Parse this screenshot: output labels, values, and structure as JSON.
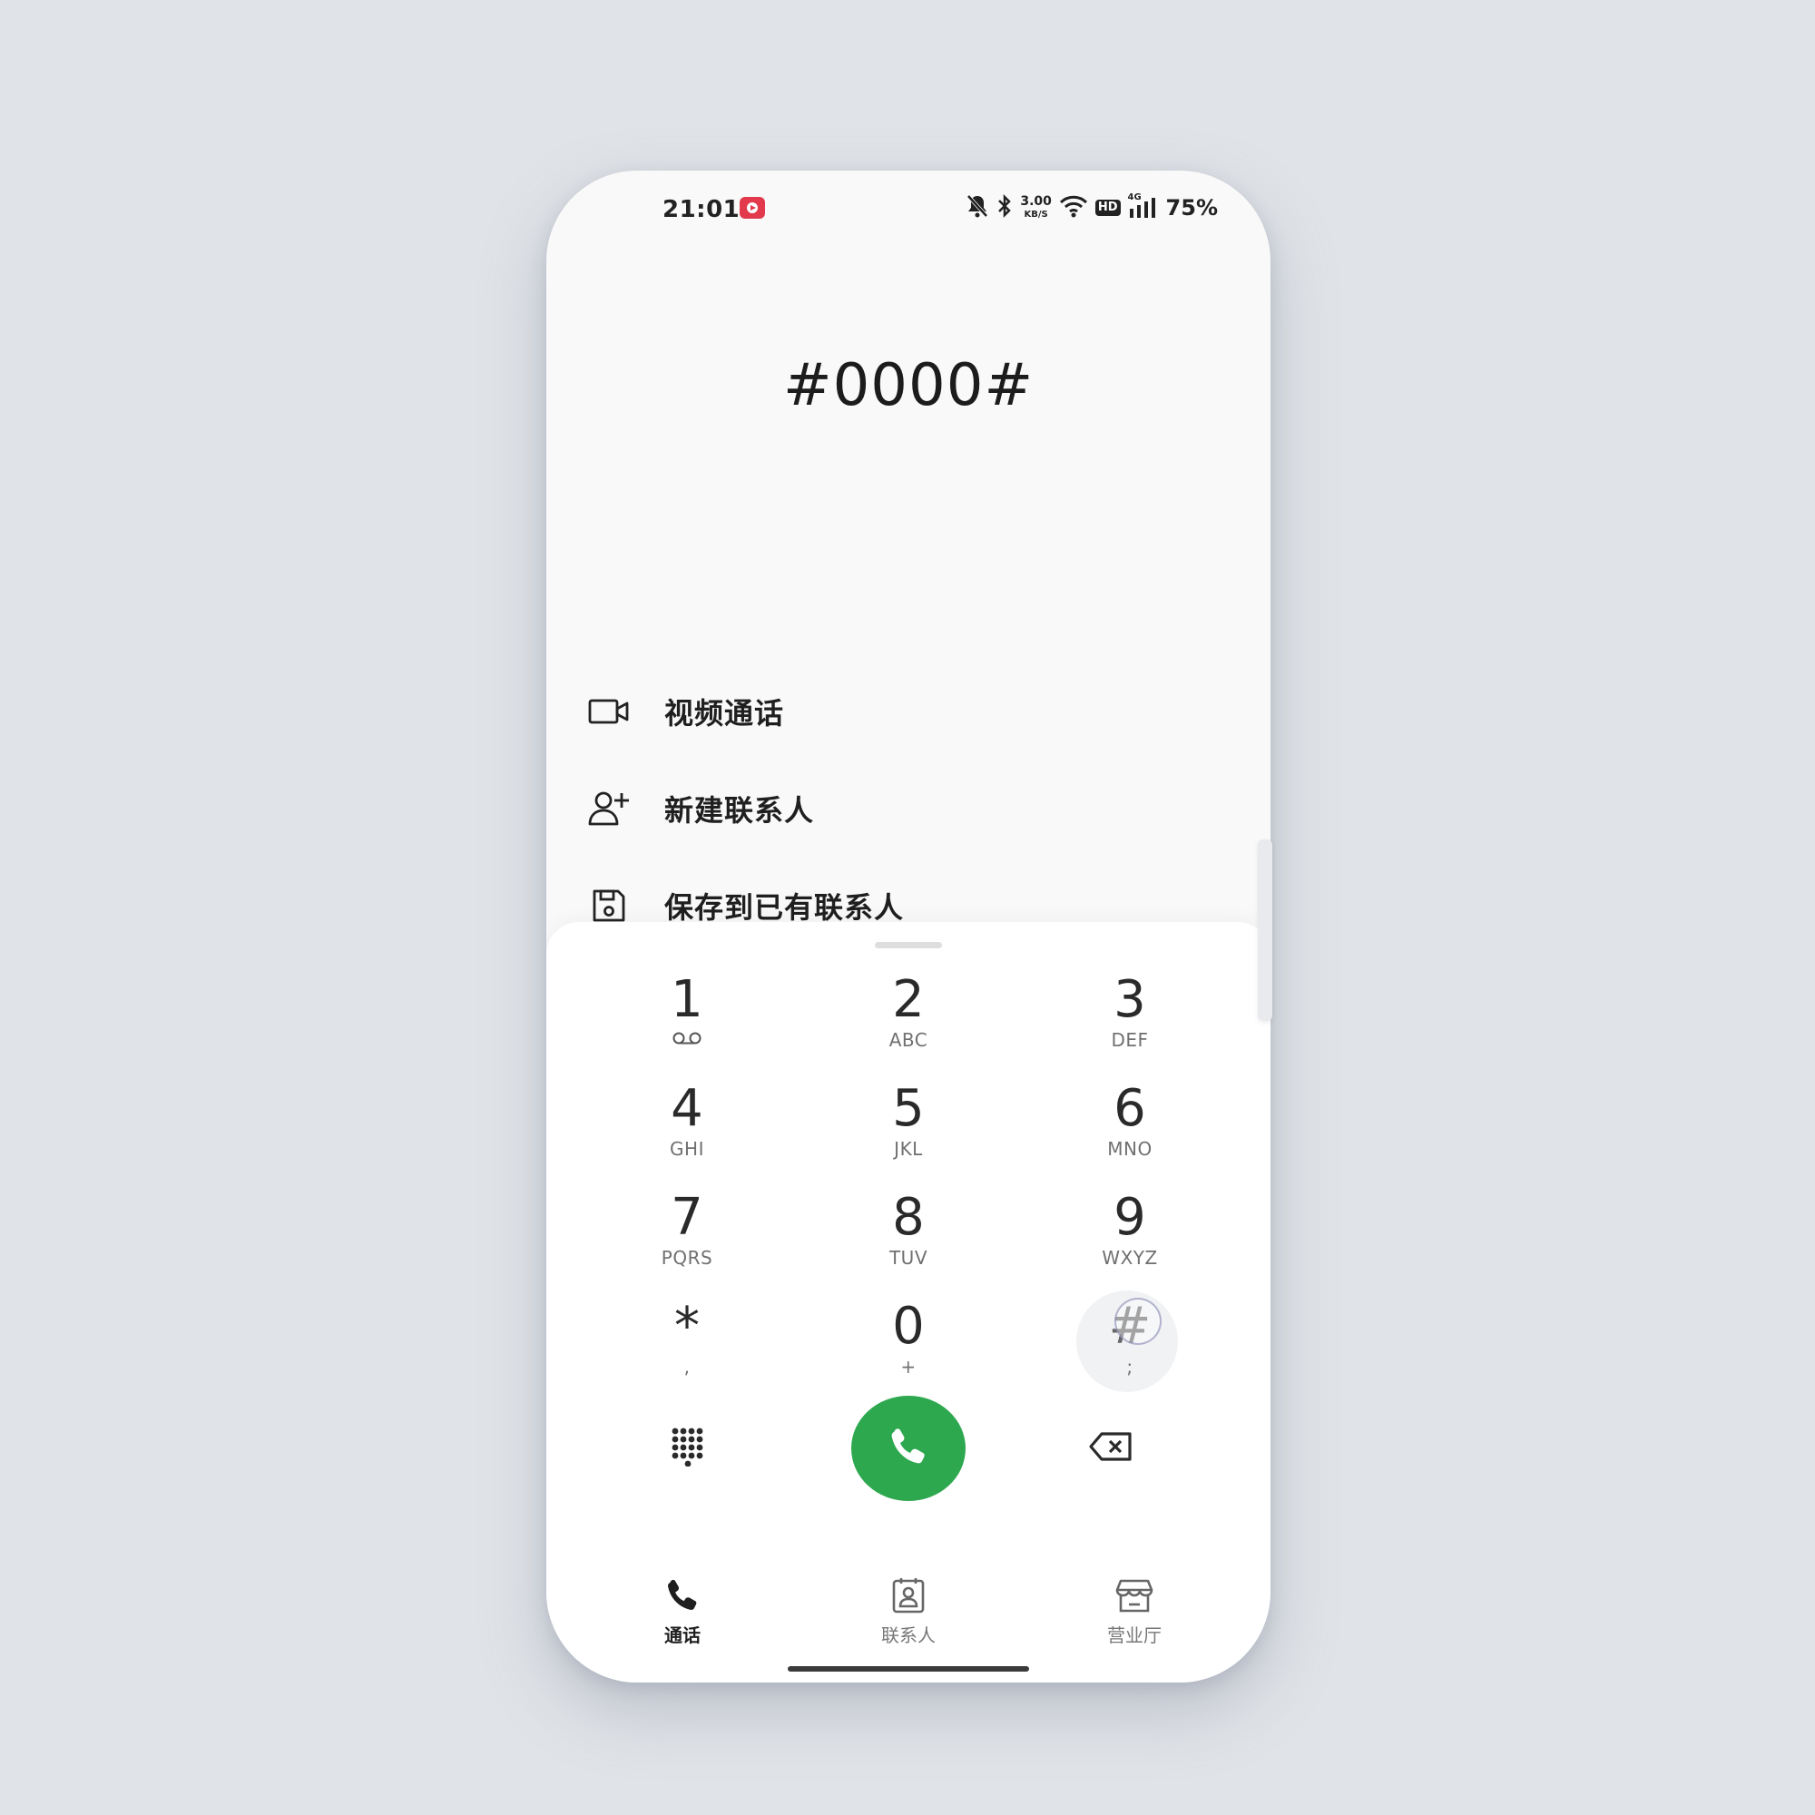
{
  "status_bar": {
    "time": "21:01",
    "net_speed_value": "3.00",
    "net_speed_unit": "KB/S",
    "hd_label": "HD",
    "network_label": "4G",
    "battery": "75%",
    "icons": [
      "screen-record-icon",
      "mute-bell-icon",
      "bluetooth-icon",
      "wifi-icon",
      "signal-icon"
    ]
  },
  "dialer": {
    "number": "#0000#"
  },
  "actions": [
    {
      "label": "视频通话",
      "icon": "video-call-icon"
    },
    {
      "label": "新建联系人",
      "icon": "add-contact-icon"
    },
    {
      "label": "保存到已有联系人",
      "icon": "save-icon"
    }
  ],
  "keypad": [
    {
      "digit": "1",
      "letters": "",
      "sub_icon": "voicemail-icon"
    },
    {
      "digit": "2",
      "letters": "ABC"
    },
    {
      "digit": "3",
      "letters": "DEF"
    },
    {
      "digit": "4",
      "letters": "GHI"
    },
    {
      "digit": "5",
      "letters": "JKL"
    },
    {
      "digit": "6",
      "letters": "MNO"
    },
    {
      "digit": "7",
      "letters": "PQRS"
    },
    {
      "digit": "8",
      "letters": "TUV"
    },
    {
      "digit": "9",
      "letters": "WXYZ"
    },
    {
      "digit": "*",
      "letters": ","
    },
    {
      "digit": "0",
      "letters": "+"
    },
    {
      "digit": "#",
      "letters": ";"
    }
  ],
  "bottom_nav": [
    {
      "label": "通话",
      "icon": "phone-icon",
      "active": true
    },
    {
      "label": "联系人",
      "icon": "contacts-icon",
      "active": false
    },
    {
      "label": "营业厅",
      "icon": "store-icon",
      "active": false
    }
  ],
  "colors": {
    "call_green": "#2ea84f",
    "record_red": "#e2394c",
    "background": "#e0e3e7"
  }
}
